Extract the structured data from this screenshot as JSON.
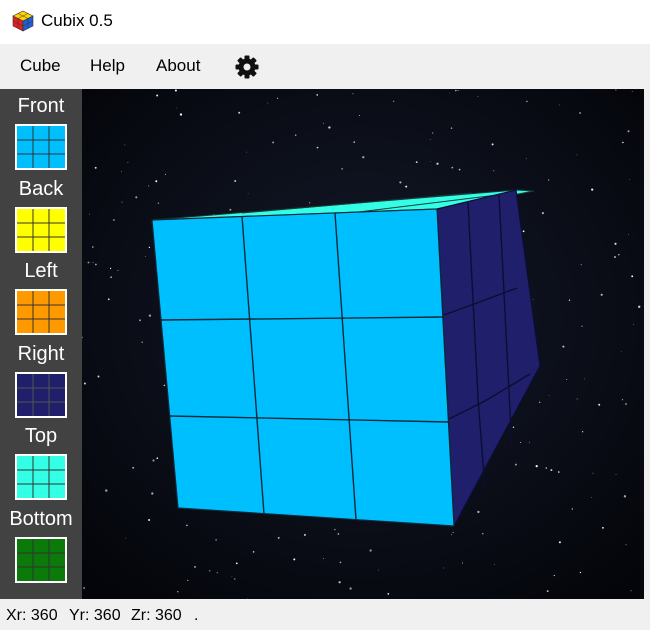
{
  "window": {
    "title": "Cubix 0.5",
    "icon": "rubiks-cube-icon"
  },
  "menubar": {
    "items": [
      "Cube",
      "Help",
      "About"
    ],
    "settings_icon": "gear-icon"
  },
  "sidebar": {
    "faces": [
      {
        "label": "Front",
        "color": "#00bfff"
      },
      {
        "label": "Back",
        "color": "#ffff00"
      },
      {
        "label": "Left",
        "color": "#ff9900"
      },
      {
        "label": "Right",
        "color": "#1f1f6b"
      },
      {
        "label": "Top",
        "color": "#33ffe6"
      },
      {
        "label": "Bottom",
        "color": "#0a7a0a"
      }
    ]
  },
  "cube_view": {
    "background": "starfield",
    "front_color": "#00bfff",
    "right_color": "#1f1f6b",
    "top_color": "#33ffe6"
  },
  "statusbar": {
    "xr": "Xr: 360",
    "yr": "Yr: 360",
    "zr": "Zr: 360",
    "extra": "."
  }
}
